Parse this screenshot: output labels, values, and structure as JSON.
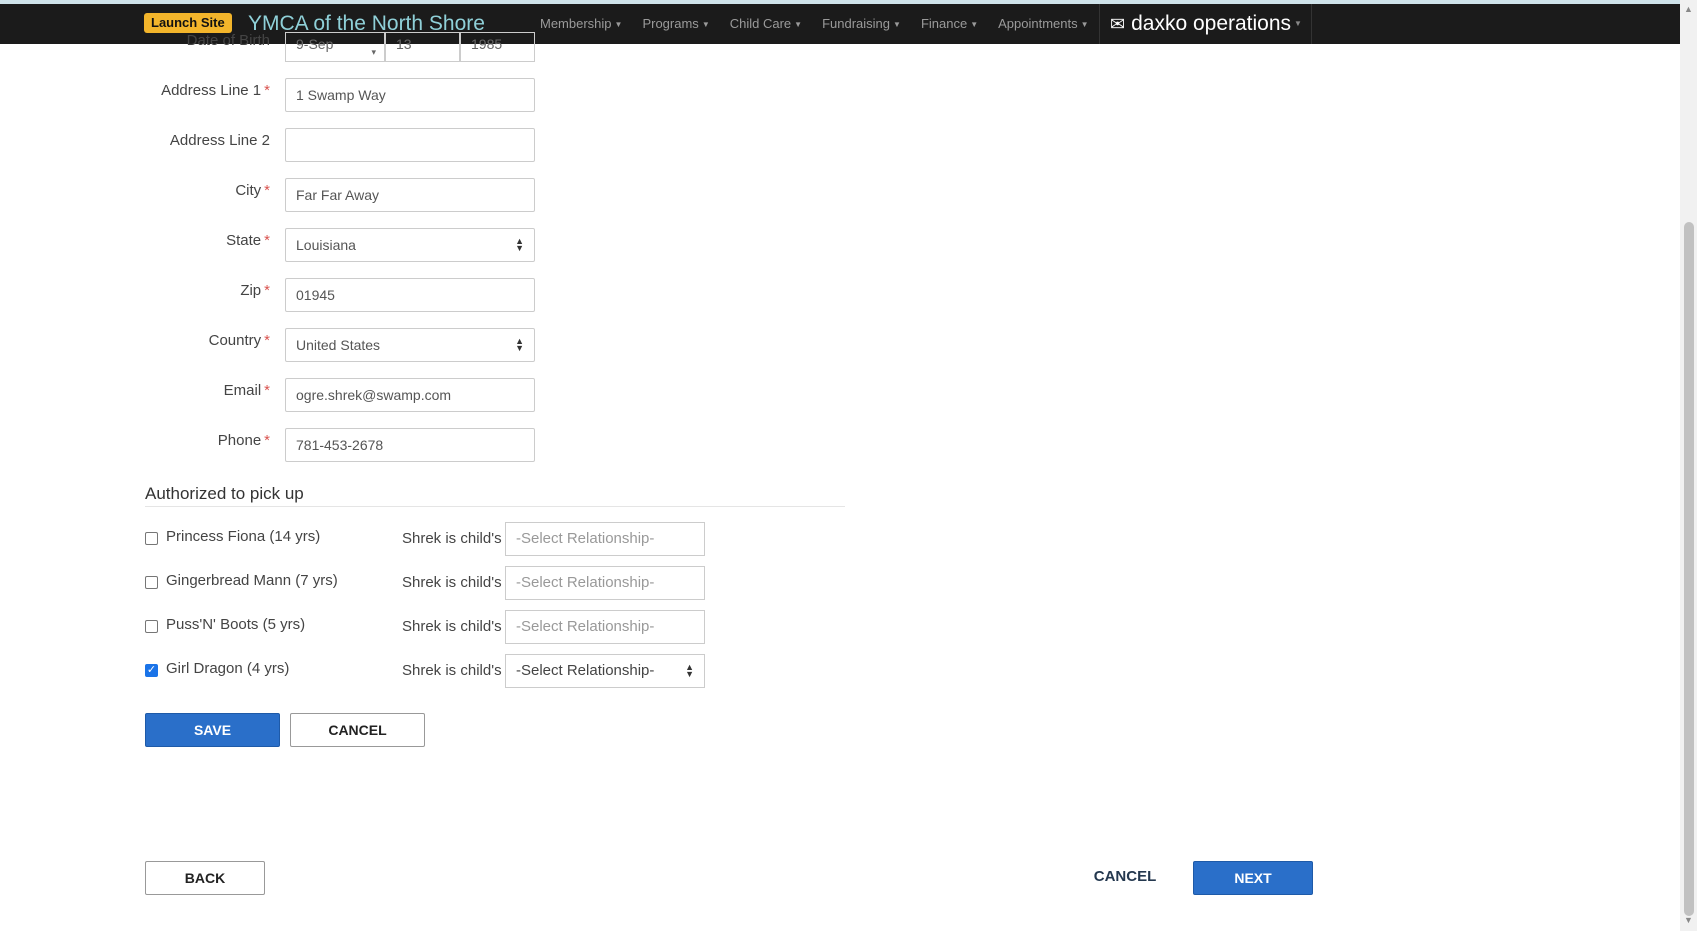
{
  "nav": {
    "launch_label": "Launch Site",
    "brand": "YMCA of the North Shore",
    "menu": [
      {
        "label": "Membership"
      },
      {
        "label": "Programs"
      },
      {
        "label": "Child Care"
      },
      {
        "label": "Fundraising"
      },
      {
        "label": "Finance"
      },
      {
        "label": "Appointments"
      }
    ],
    "product": "daxko operations"
  },
  "form": {
    "dob": {
      "label": "Date of Birth",
      "month": "9-Sep",
      "day": "13",
      "year": "1985"
    },
    "address1": {
      "label": "Address Line 1",
      "value": "1 Swamp Way"
    },
    "address2": {
      "label": "Address Line 2",
      "value": ""
    },
    "city": {
      "label": "City",
      "value": "Far Far Away"
    },
    "state": {
      "label": "State",
      "value": "Louisiana"
    },
    "zip": {
      "label": "Zip",
      "value": "01945"
    },
    "country": {
      "label": "Country",
      "value": "United States"
    },
    "email": {
      "label": "Email",
      "value": "ogre.shrek@swamp.com"
    },
    "phone": {
      "label": "Phone",
      "value": "781-453-2678"
    },
    "required_mark": "*"
  },
  "pickup": {
    "title": "Authorized to pick up",
    "relationship_prefix": "Shrek is child's",
    "placeholder": "-Select Relationship-",
    "children": [
      {
        "name": "Princess Fiona (14 yrs)",
        "checked": false
      },
      {
        "name": "Gingerbread Mann (7 yrs)",
        "checked": false
      },
      {
        "name": "Puss'N' Boots (5 yrs)",
        "checked": false
      },
      {
        "name": "Girl Dragon (4 yrs)",
        "checked": true
      }
    ]
  },
  "actions": {
    "save": "SAVE",
    "cancel": "CANCEL",
    "back": "BACK",
    "cancel_link": "CANCEL",
    "next": "NEXT"
  },
  "colors": {
    "primary": "#2a6fc9",
    "launch": "#f3b52b",
    "brand_text": "#8fd0d8",
    "required": "#d9534f"
  }
}
